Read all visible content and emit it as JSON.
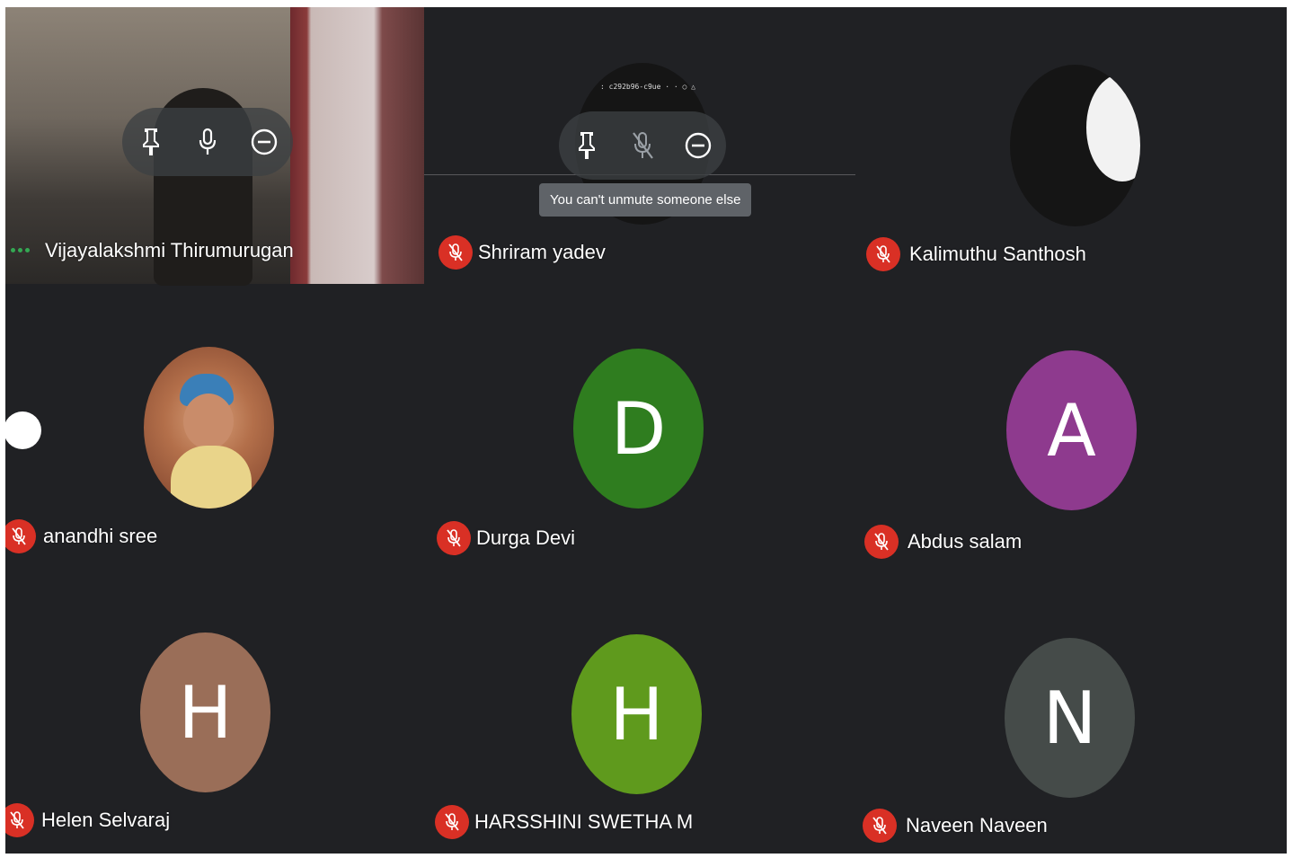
{
  "participants": [
    {
      "name": "Vijayalakshmi Thirumurugan",
      "tile_type": "video",
      "speaking_indicator": true,
      "muted": false
    },
    {
      "name": "Shriram yadev",
      "tile_type": "dark-photo",
      "muted": true
    },
    {
      "name": "Kalimuthu Santhosh",
      "tile_type": "dark-photo",
      "muted": true
    },
    {
      "name": "anandhi sree",
      "tile_type": "photo",
      "muted": true
    },
    {
      "name": "Durga Devi",
      "tile_type": "letter",
      "letter": "D",
      "color": "#2f7d1f",
      "muted": true
    },
    {
      "name": "Abdus salam",
      "tile_type": "letter",
      "letter": "A",
      "color": "#8e3a8e",
      "muted": true
    },
    {
      "name": "Helen Selvaraj",
      "tile_type": "letter",
      "letter": "H",
      "color": "#9a6e58",
      "muted": true
    },
    {
      "name": "HARSSHINI SWETHA M",
      "tile_type": "letter",
      "letter": "H",
      "color": "#5f9a1d",
      "muted": true
    },
    {
      "name": "Naveen Naveen",
      "tile_type": "letter",
      "letter": "N",
      "color": "#454b49",
      "muted": true
    }
  ],
  "tile_controls": {
    "icons": [
      "pin-icon",
      "mic-icon",
      "remove-icon"
    ],
    "disabled_mic_icon": "mic-off-icon"
  },
  "tooltip": {
    "text": "You can't unmute someone else"
  },
  "colors": {
    "grid_background": "#202124",
    "muted_badge": "#d93025",
    "speaking_dots": "#34a853",
    "control_pill": "#3c4043",
    "tooltip_bg": "#5f6368"
  }
}
